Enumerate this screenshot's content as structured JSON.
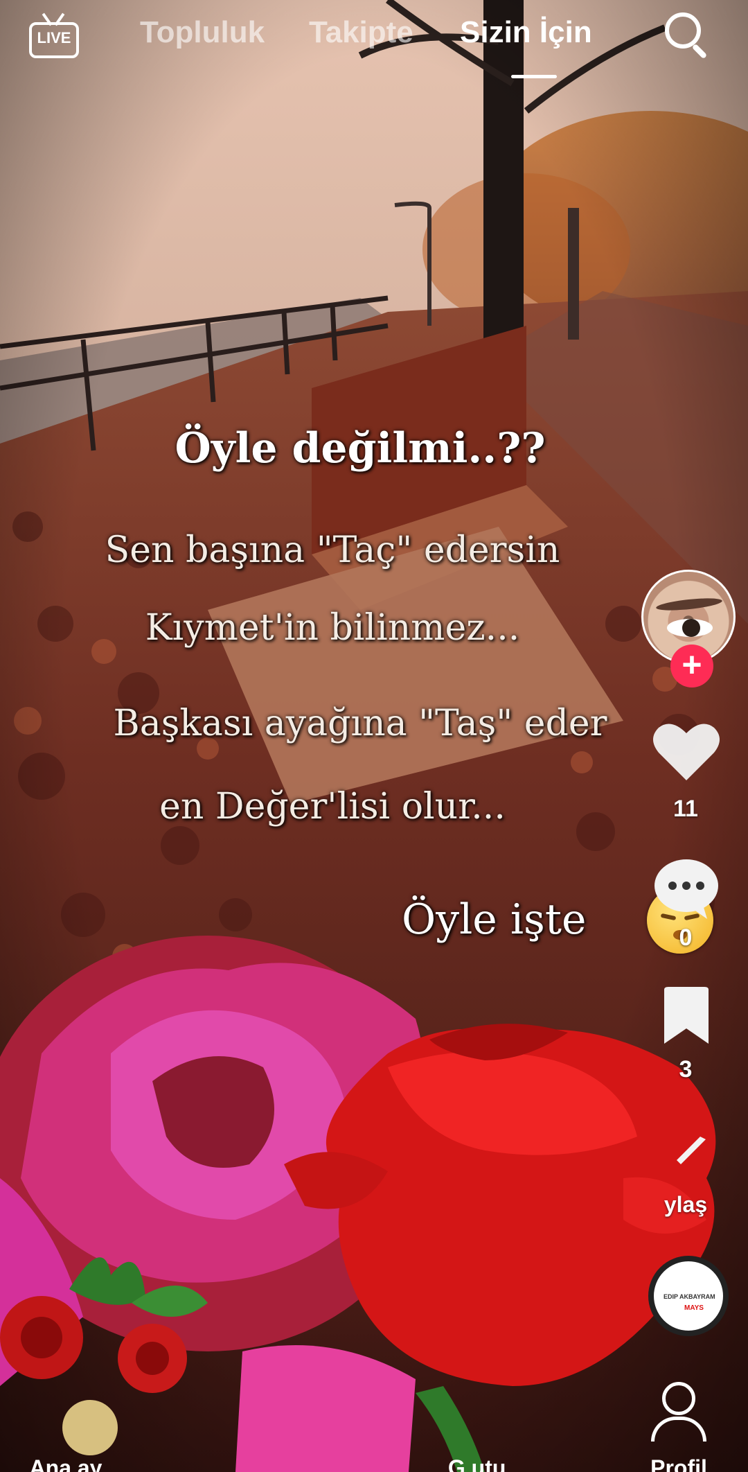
{
  "top_nav": {
    "live_label": "LIVE",
    "tabs": [
      {
        "label": "Topluluk",
        "active": false
      },
      {
        "label": "Takipte",
        "active": false
      },
      {
        "label": "Sizin İçin",
        "active": true
      }
    ]
  },
  "video": {
    "overlay_title": "Öyle değilmi..??",
    "overlay_lines": [
      "Sen başına \"Taç\" edersin",
      "Kıymet'in bilinmez...",
      "Başkası ayağına \"Taş\" eder",
      "en Değer'lisi olur..."
    ],
    "overlay_closing": "Öyle işte"
  },
  "rail": {
    "like_count": "11",
    "comment_count": "0",
    "bookmark_count": "3",
    "share_label": "ylaş",
    "music_disc_text_1": "EDIP AKBAYRAM",
    "music_disc_text_2": "MAYS"
  },
  "bottom_nav": {
    "home_label": "Ana ay",
    "inbox_label": "G   utu...",
    "profile_label": "Profil"
  },
  "colors": {
    "accent": "#fe2c55",
    "active_tab": "#ffffff",
    "inactive_tab": "#ffffff99"
  }
}
